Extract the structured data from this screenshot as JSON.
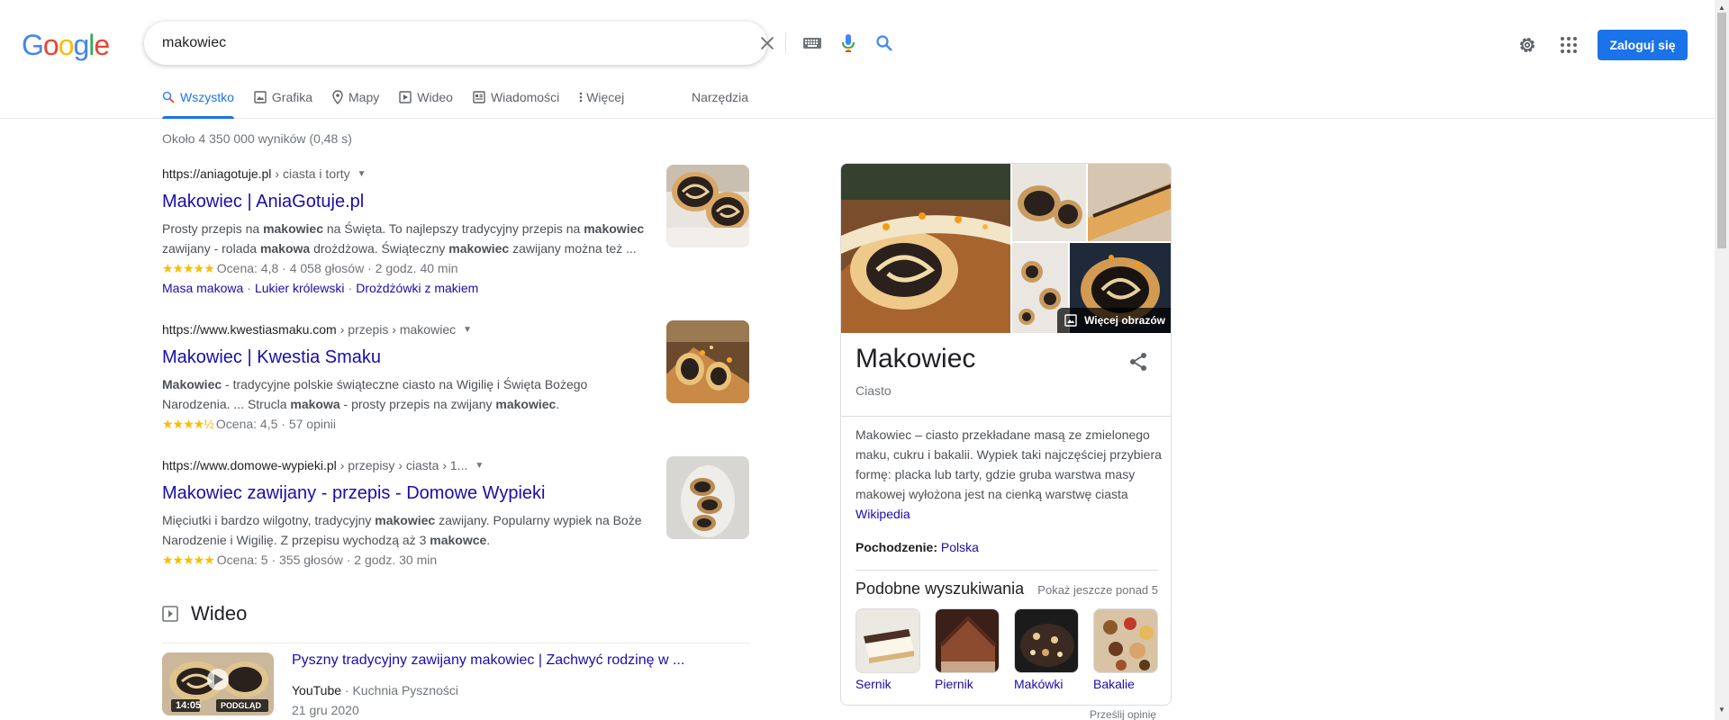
{
  "logo": {
    "letters": [
      "G",
      "o",
      "o",
      "g",
      "l",
      "e"
    ],
    "colors": [
      "#4285F4",
      "#EA4335",
      "#FBBC05",
      "#4285F4",
      "#34A853",
      "#EA4335"
    ]
  },
  "search": {
    "query": "makowiec"
  },
  "header": {
    "signin_label": "Zaloguj się"
  },
  "tabs": [
    {
      "label": "Wszystko",
      "icon": "search-icon",
      "active": true
    },
    {
      "label": "Grafika",
      "icon": "image-icon"
    },
    {
      "label": "Mapy",
      "icon": "map-pin-icon"
    },
    {
      "label": "Wideo",
      "icon": "play-icon"
    },
    {
      "label": "Wiadomości",
      "icon": "news-icon"
    },
    {
      "label": "Więcej",
      "icon": "more-vert-icon"
    }
  ],
  "tools_label": "Narzędzia",
  "result_stats": "Około 4 350 000 wyników (0,48 s)",
  "results": [
    {
      "domain": "https://aniagotuje.pl",
      "crumbs": "› ciasta i torty",
      "title": "Makowiec | AniaGotuje.pl",
      "snippet_html": "Prosty przepis na <b>makowiec</b> na Święta. To najlepszy tradycyjny przepis na <b>makowiec</b> zawijany - rolada <b>makowa</b> drożdżowa. Świąteczny <b>makowiec</b> zawijany można też ...",
      "stars": "★★★★★",
      "rating": "Ocena: 4,8 · 4 058 głosów · 2 godz. 40 min",
      "sitelinks": [
        "Masa makowa",
        "Lukier królewski",
        "Drożdżówki z makiem"
      ]
    },
    {
      "domain": "https://www.kwestiasmaku.com",
      "crumbs": "› przepis › makowiec",
      "title": "Makowiec | Kwestia Smaku",
      "snippet_html": "<b>Makowiec</b> - tradycyjne polskie świąteczne ciasto na Wigilię i Święta Bożego Narodzenia. ... Strucla <b>makowa</b> - prosty przepis na zwijany <b>makowiec</b>.",
      "stars": "★★★★½",
      "rating": "Ocena: 4,5 · 57 opinii",
      "sitelinks": []
    },
    {
      "domain": "https://www.domowe-wypieki.pl",
      "crumbs": "› przepisy › ciasta › 1...",
      "title": "Makowiec zawijany - przepis - Domowe Wypieki",
      "snippet_html": "Mięciutki i bardzo wilgotny, tradycyjny <b>makowiec</b> zawijany. Popularny wypiek na Boże Narodzenie i Wigilię. Z przepisu wychodzą aż 3 <b>makowce</b>.",
      "stars": "★★★★★",
      "rating": "Ocena: 5 · 355 głosów · 2 godz. 30 min",
      "sitelinks": []
    }
  ],
  "video": {
    "section_title": "Wideo",
    "title": "Pyszny tradycyjny zawijany makowiec | Zachwyć rodzinę w ...",
    "source": "YouTube",
    "channel": "Kuchnia Pyszności",
    "date": "21 gru 2020",
    "duration": "14:05",
    "preview_label": "PODGLĄD"
  },
  "knowledge_panel": {
    "title": "Makowiec",
    "subtitle": "Ciasto",
    "more_images": "Więcej obrazów",
    "description": "Makowiec – ciasto przekładane masą ze zmielonego maku, cukru i bakalii. Wypiek taki najczęściej przybiera formę: placka lub tarty, gdzie gruba warstwa masy makowej wyłożona jest na cienką warstwę ciasta",
    "wiki_link": "Wikipedia",
    "origin_label": "Pochodzenie:",
    "origin_value": "Polska",
    "similar_title": "Podobne wyszukiwania",
    "similar_more": "Pokaż jeszcze ponad 5",
    "similar": [
      "Sernik",
      "Piernik",
      "Makówki",
      "Bakalie"
    ]
  },
  "feedback": "Prześlij opinię"
}
